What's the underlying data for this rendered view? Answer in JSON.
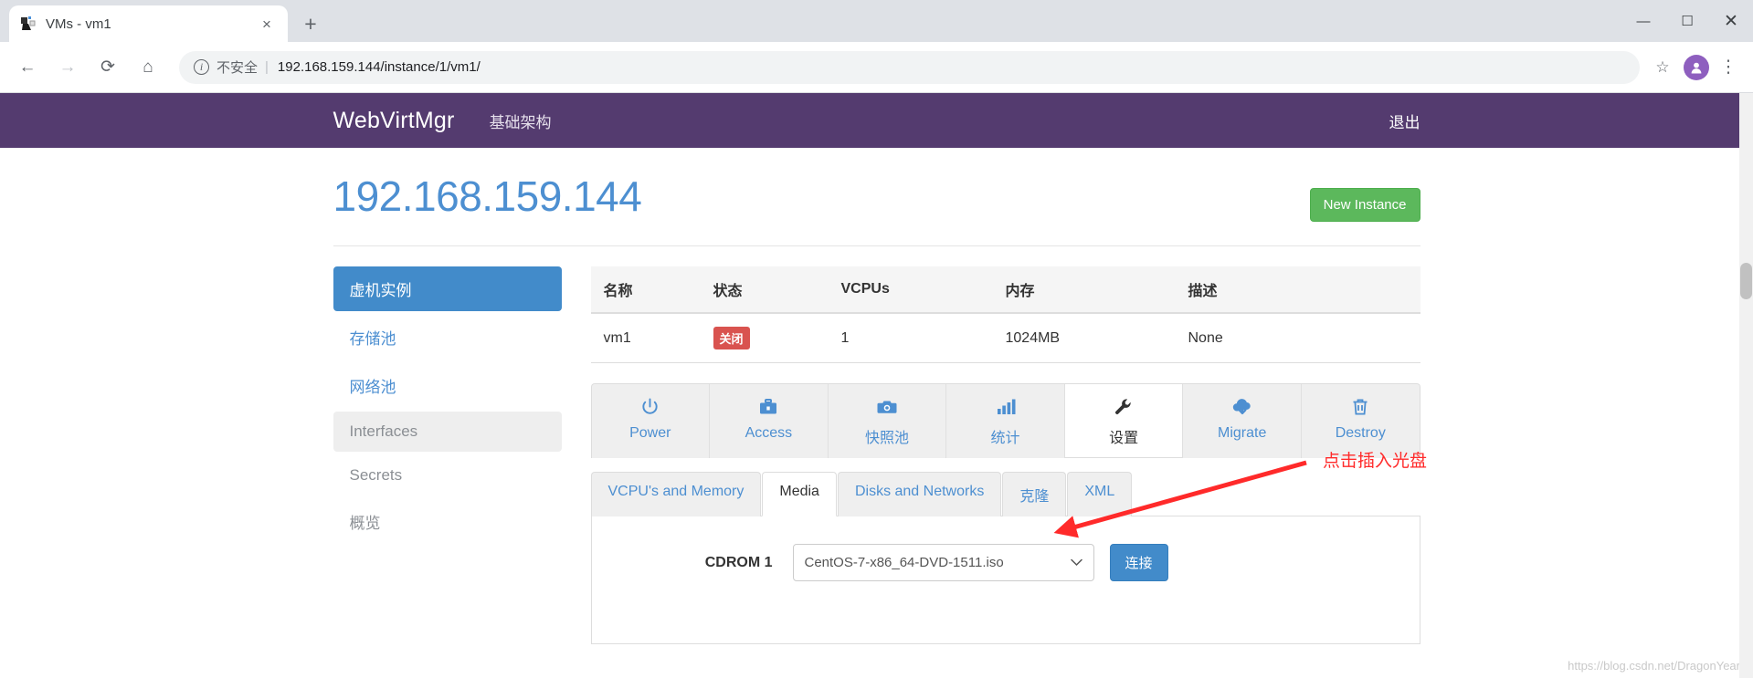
{
  "browser": {
    "tab": {
      "title": "VMs - vm1",
      "favicon": "vm-favicon",
      "close_label": "×"
    },
    "new_tab_label": "+",
    "window_controls": {
      "minimize": "—",
      "maximize": "☐",
      "close": "✕"
    },
    "nav": {
      "back": "←",
      "forward": "→",
      "reload": "⟳",
      "home": "⌂"
    },
    "omnibox": {
      "security_label": "不安全",
      "separator": "|",
      "url": "192.168.159.144/instance/1/vm1/",
      "star": "☆",
      "profile_initial": "●",
      "menu": "⋮"
    }
  },
  "navbar": {
    "brand": "WebVirtMgr",
    "links": [
      {
        "label": "基础架构"
      }
    ],
    "right_link": "退出",
    "bg_color": "#543b6f"
  },
  "header": {
    "title": "192.168.159.144",
    "title_color": "#4d8fd1",
    "new_instance_label": "New Instance",
    "new_instance_color": "#5cb85c"
  },
  "sidebar": {
    "items": [
      {
        "label": "虚机实例",
        "state": "active"
      },
      {
        "label": "存储池",
        "state": "normal"
      },
      {
        "label": "网络池",
        "state": "normal"
      },
      {
        "label": "Interfaces",
        "state": "hover"
      },
      {
        "label": "Secrets",
        "state": "muted"
      },
      {
        "label": "概览",
        "state": "muted"
      }
    ]
  },
  "vm_table": {
    "headers": [
      "名称",
      "状态",
      "VCPUs",
      "内存",
      "描述"
    ],
    "rows": [
      {
        "name": "vm1",
        "status": "关闭",
        "status_color": "#d9534f",
        "vcpus": "1",
        "memory": "1024MB",
        "description": "None"
      }
    ]
  },
  "action_tabs": [
    {
      "label": "Power",
      "icon": "power-icon",
      "active": false
    },
    {
      "label": "Access",
      "icon": "briefcase-icon",
      "active": false
    },
    {
      "label": "快照池",
      "icon": "camera-icon",
      "active": false
    },
    {
      "label": "统计",
      "icon": "bar-chart-icon",
      "active": false
    },
    {
      "label": "设置",
      "icon": "wrench-icon",
      "active": true
    },
    {
      "label": "Migrate",
      "icon": "cloud-download-icon",
      "active": false
    },
    {
      "label": "Destroy",
      "icon": "trash-icon",
      "active": false
    }
  ],
  "sub_tabs": [
    {
      "label": "VCPU's and Memory",
      "active": false
    },
    {
      "label": "Media",
      "active": true
    },
    {
      "label": "Disks and Networks",
      "active": false
    },
    {
      "label": "克隆",
      "active": false
    },
    {
      "label": "XML",
      "active": false
    }
  ],
  "media_panel": {
    "cdrom_label": "CDROM 1",
    "selected_iso": "CentOS-7-x86_64-DVD-1511.iso",
    "caret": "⌄",
    "connect_label": "连接",
    "connect_color": "#428bca"
  },
  "annotation": {
    "text": "点击插入光盘",
    "color": "#ff2a2a"
  },
  "watermark": "https://blog.csdn.net/DragonYear"
}
